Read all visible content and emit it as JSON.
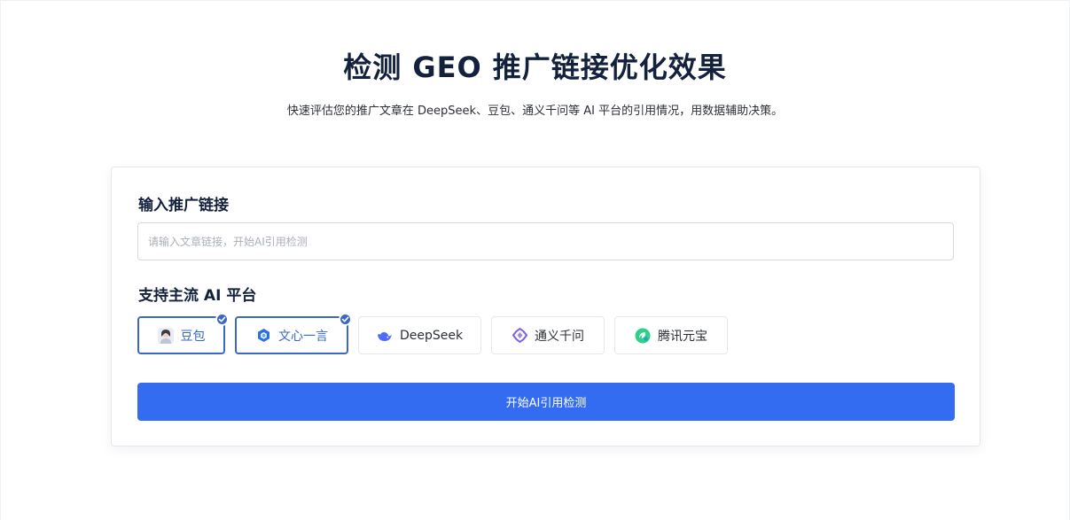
{
  "header": {
    "title": "检测 GEO 推广链接优化效果",
    "subtitle": "快速评估您的推广文章在 DeepSeek、豆包、通义千问等 AI 平台的引用情况，用数据辅助决策。"
  },
  "form": {
    "link_label": "输入推广链接",
    "link_input": {
      "value": "",
      "placeholder": "请输入文章链接，开始AI引用检测"
    },
    "platforms_label": "支持主流 AI 平台",
    "platforms": [
      {
        "label": "豆包",
        "icon": "doubao-avatar-icon",
        "selected": true
      },
      {
        "label": "文心一言",
        "icon": "wenxin-cube-icon",
        "selected": true
      },
      {
        "label": "DeepSeek",
        "icon": "deepseek-whale-icon",
        "selected": false
      },
      {
        "label": "通义千问",
        "icon": "tongyi-star-icon",
        "selected": false
      },
      {
        "label": "腾讯元宝",
        "icon": "yuanbao-leaf-icon",
        "selected": false
      }
    ],
    "submit_label": "开始AI引用检测"
  },
  "colors": {
    "accent": "#336cf0",
    "selected_border": "#3a68c4",
    "title": "#14213d"
  }
}
